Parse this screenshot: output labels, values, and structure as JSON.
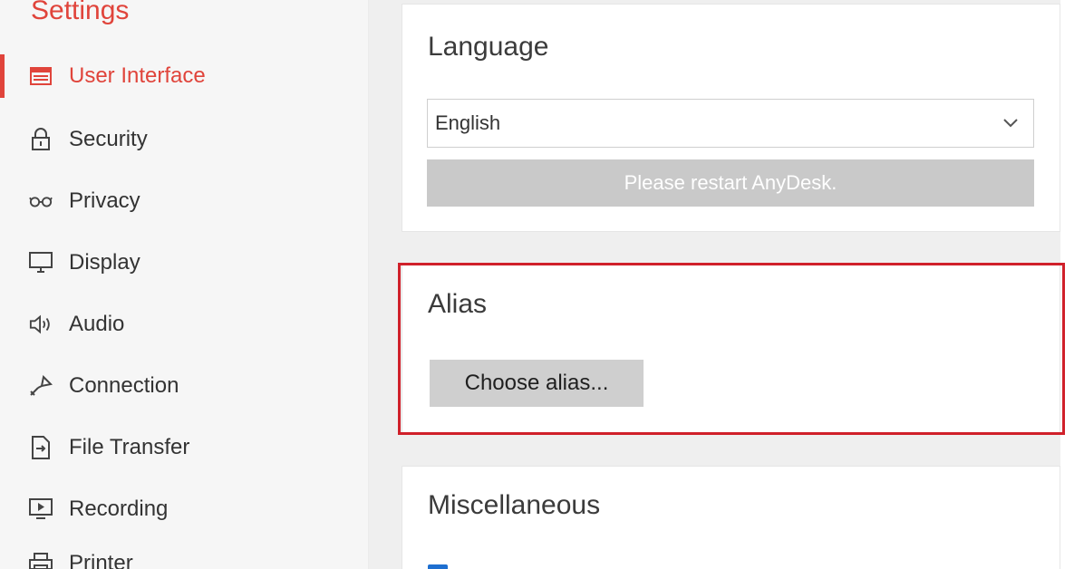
{
  "sidebar": {
    "title": "Settings",
    "items": [
      {
        "label": "User Interface",
        "icon": "user-interface-icon",
        "active": true
      },
      {
        "label": "Security",
        "icon": "lock-icon"
      },
      {
        "label": "Privacy",
        "icon": "glasses-icon"
      },
      {
        "label": "Display",
        "icon": "monitor-icon"
      },
      {
        "label": "Audio",
        "icon": "speaker-icon"
      },
      {
        "label": "Connection",
        "icon": "connection-icon"
      },
      {
        "label": "File Transfer",
        "icon": "file-transfer-icon"
      },
      {
        "label": "Recording",
        "icon": "recording-icon"
      },
      {
        "label": "Printer",
        "icon": "printer-icon"
      }
    ]
  },
  "language": {
    "title": "Language",
    "selected": "English",
    "notice": "Please restart AnyDesk."
  },
  "alias": {
    "title": "Alias",
    "button": "Choose alias..."
  },
  "misc": {
    "title": "Miscellaneous"
  },
  "colors": {
    "accent": "#e0443b",
    "highlight": "#d0202a"
  }
}
